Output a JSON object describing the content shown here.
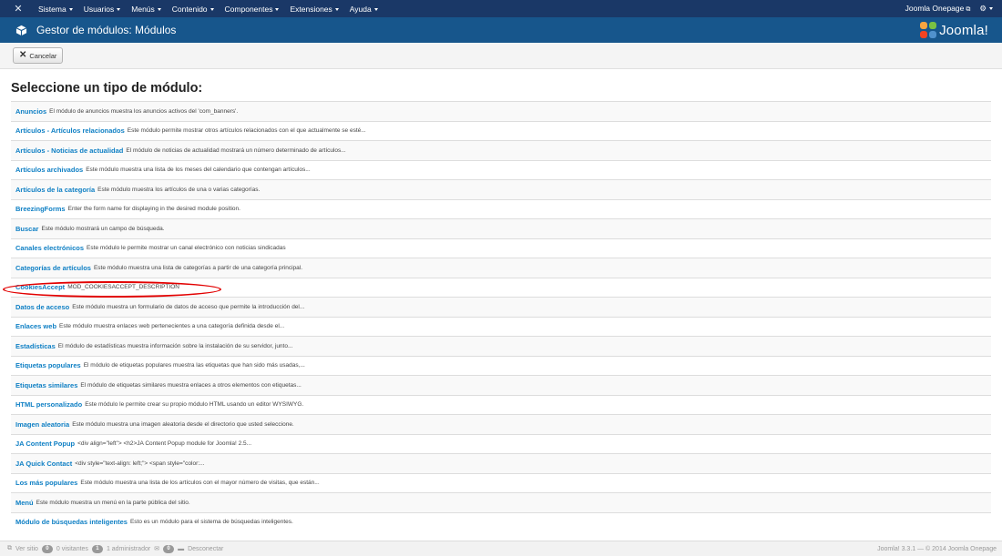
{
  "navbar": {
    "menu": [
      "Sistema",
      "Usuarios",
      "Menús",
      "Contenido",
      "Componentes",
      "Extensiones",
      "Ayuda"
    ],
    "site_link": "Joomla Onepage"
  },
  "titlebar": {
    "title": "Gestor de módulos: Módulos",
    "logo_text": "Joomla!"
  },
  "toolbar": {
    "cancel_label": "Cancelar"
  },
  "heading": "Seleccione un tipo de módulo:",
  "modules": [
    {
      "name": "Anuncios",
      "desc": "El módulo de anuncios muestra los anuncios activos del 'com_banners'."
    },
    {
      "name": "Artículos - Artículos relacionados",
      "desc": "Este módulo permite mostrar otros artículos relacionados con el que actualmente se esté..."
    },
    {
      "name": "Artículos - Noticias de actualidad",
      "desc": "El módulo de noticias de actualidad mostrará un número determinado de artículos..."
    },
    {
      "name": "Artículos archivados",
      "desc": "Este módulo muestra una lista de los meses del calendario que contengan artículos..."
    },
    {
      "name": "Artículos de la categoría",
      "desc": "Este módulo muestra los artículos de una o varias categorías."
    },
    {
      "name": "BreezingForms",
      "desc": "Enter the form name for displaying in the desired module position."
    },
    {
      "name": "Buscar",
      "desc": "Este módulo mostrará un campo de búsqueda."
    },
    {
      "name": "Canales electrónicos",
      "desc": "Este módulo le permite mostrar un canal electrónico con noticias sindicadas"
    },
    {
      "name": "Categorías de artículos",
      "desc": "Este módulo muestra una lista de categorías a partir de una categoría principal."
    },
    {
      "name": "CookiesAccept",
      "desc": "MOD_COOKIESACCEPT_DESCRIPTION"
    },
    {
      "name": "Datos de acceso",
      "desc": "Este módulo muestra un formulario de datos de acceso que permite la introducción del..."
    },
    {
      "name": "Enlaces web",
      "desc": "Este módulo muestra enlaces web pertenecientes a una categoría definida desde el..."
    },
    {
      "name": "Estadísticas",
      "desc": "El módulo de estadísticas muestra información sobre la instalación de su servidor, junto..."
    },
    {
      "name": "Etiquetas populares",
      "desc": "El módulo de etiquetas populares muestra las etiquetas que han sido más usadas,..."
    },
    {
      "name": "Etiquetas similares",
      "desc": "El módulo de etiquetas similares muestra enlaces a otros elementos con etiquetas..."
    },
    {
      "name": "HTML personalizado",
      "desc": "Este módulo le permite crear su propio módulo HTML usando un editor WYSIWYG."
    },
    {
      "name": "Imagen aleatoria",
      "desc": "Este módulo muestra una imagen aleatoria desde el directorio que usted seleccione."
    },
    {
      "name": "JA Content Popup",
      "desc": "<div align=\"left\"> <h2>JA Content Popup module for Joomla! 2.5..."
    },
    {
      "name": "JA Quick Contact",
      "desc": "<div style=\"text-align: left;\"> <span style=\"color:..."
    },
    {
      "name": "Los más populares",
      "desc": "Este módulo muestra una lista de los artículos con el mayor número de visitas, que están..."
    },
    {
      "name": "Menú",
      "desc": "Este módulo muestra un menú en la parte pública del sitio."
    },
    {
      "name": "Módulo de búsquedas inteligentes",
      "desc": "Esto es un módulo para el sistema de búsquedas inteligentes."
    }
  ],
  "footer": {
    "view_site": "Ver sitio",
    "visitors_count": "0",
    "visitors_label": "0 visitantes",
    "admins_count": "1",
    "admins_label": "1 administrador",
    "messages_count": "0",
    "logout": "Desconectar",
    "version": "Joomla! 3.3.1 — © 2014 Joomla Onepage"
  },
  "colors": {
    "navbar": "#1a3867",
    "titlebar": "#17568c",
    "link": "#0e7fc4",
    "annotation": "#e20000"
  }
}
